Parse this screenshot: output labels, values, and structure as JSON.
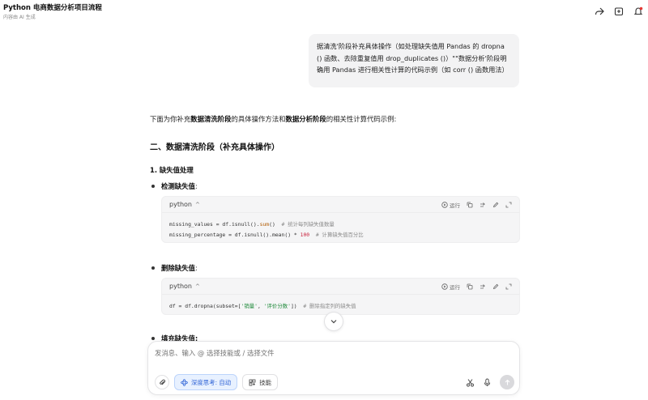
{
  "header": {
    "title": "Python 电商数据分析项目流程",
    "subtitle": "内容由 AI 生成",
    "icons": [
      "share-icon",
      "bookmark-icon",
      "notification-icon"
    ]
  },
  "user_message": "据清洗'阶段补充具体操作（如处理缺失值用 Pandas 的 dropna () 函数、去除重复值用 drop_duplicates ()）\"\"数据分析'阶段明确用 Pandas 进行相关性计算的代码示例（如 corr () 函数用法）",
  "response": {
    "intro_prefix": "下面为你补充",
    "intro_bold1": "数据清洗阶段",
    "intro_mid": "的具体操作方法和",
    "intro_bold2": "数据分析阶段",
    "intro_suffix": "的相关性计算代码示例:",
    "section_title": "二、数据清洗阶段（补充具体操作）",
    "subsection_title": "1. 缺失值处理",
    "bullets": [
      {
        "label": "检测缺失值",
        "suffix": ":"
      },
      {
        "label": "删除缺失值",
        "suffix": ":"
      },
      {
        "label": "填充缺失值",
        "suffix": ":"
      }
    ],
    "code_blocks": [
      {
        "language": "python",
        "run_label": "运行",
        "lines": [
          {
            "code": "missing_values = df.isnull().",
            "fn": "sum",
            "rest": "()  ",
            "comment": "# 统计每列缺失值数量"
          },
          {
            "code": "missing_percentage = df.isnull().mean() * ",
            "num": "100",
            "rest": "  ",
            "comment": "# 计算缺失值百分比"
          }
        ]
      },
      {
        "language": "python",
        "run_label": "运行",
        "line": {
          "prefix": "df = df.dropna(subset=[",
          "str1": "'销量'",
          "sep": ", ",
          "str2": "'评价分数'",
          "suffix": "])  ",
          "comment": "# 删除指定列的缺失值"
        }
      }
    ]
  },
  "composer": {
    "placeholder": "发消息、输入 @ 选择技能或 / 选择文件",
    "deep_think_label": "深度思考: 自动",
    "skills_label": "技能"
  },
  "colors": {
    "accent": "#2e63d6",
    "code_bg": "#f5f5f6",
    "bubble_bg": "#f3f3f4"
  }
}
